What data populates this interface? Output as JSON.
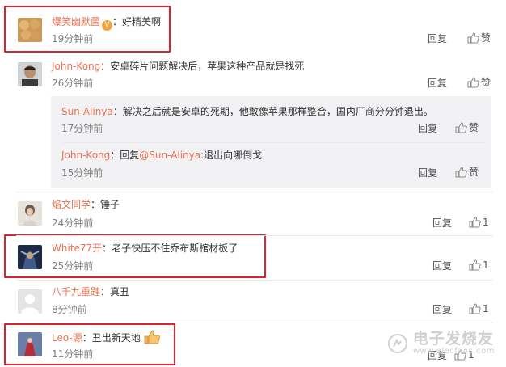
{
  "actions": {
    "reply": "回复",
    "like": "赞"
  },
  "comments": [
    {
      "user": "爆笑幽默菌",
      "text": "好精美啊",
      "time": "19分钟前",
      "like_label": "赞",
      "badge": "V"
    },
    {
      "user": "John-Kong",
      "text": "安卓碎片问题解决后，苹果这种产品就是找死",
      "time": "26分钟前",
      "like_label": "赞"
    },
    {
      "user": "焰文同学",
      "text": "锤子",
      "time": "24分钟前",
      "like_count": "1"
    },
    {
      "user": "White77开",
      "text": "老子快压不住乔布斯棺材板了",
      "time": "25分钟前",
      "like_count": "1"
    },
    {
      "user": "八千九重韪",
      "text": "真丑",
      "time": "8分钟前",
      "like_count": "1"
    },
    {
      "user": "Leo-源",
      "text": "丑出新天地",
      "time": "11分钟前",
      "like_count": "1"
    }
  ],
  "replies": [
    {
      "user": "Sun-Alinya",
      "text": "解决之后就是安卓的死期，他敢像苹果那样整合，国内厂商分分钟退出。",
      "time": "17分钟前"
    },
    {
      "user": "John-Kong",
      "text_prefix": "回复",
      "mention": "@Sun-Alinya",
      "text_suffix": ":退出向哪倒戈",
      "time": "15分钟前"
    }
  ],
  "watermark": {
    "text": "电子发烧友",
    "url": "www.elecfans.com"
  },
  "colors": {
    "username": "#eb7350",
    "highlight": "#d9232e",
    "reply_bg": "#f2f2f5",
    "time": "#808080"
  }
}
